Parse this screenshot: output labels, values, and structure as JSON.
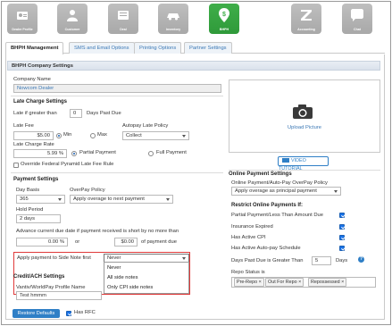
{
  "nav": {
    "items": [
      {
        "label": "Dealer Profile"
      },
      {
        "label": "Customer"
      },
      {
        "label": "Deal"
      },
      {
        "label": "Inventory"
      },
      {
        "label": "BHPH"
      },
      {
        "label": "Accounting"
      },
      {
        "label": "Chat"
      }
    ],
    "active_color": "#3fae49"
  },
  "tabs": [
    {
      "label": "BHPH Management"
    },
    {
      "label": "SMS and Email Options"
    },
    {
      "label": "Printing Options"
    },
    {
      "label": "Partner Settings"
    }
  ],
  "company": {
    "section": "BHPH Company Settings",
    "name_label": "Company Name",
    "name_value": "Nowcom Dealer"
  },
  "late": {
    "heading": "Late Charge Settings",
    "if_greater_label": "Late if greater than",
    "if_greater_value": "0",
    "days_past_due": "Days Past Due",
    "fee_label": "Late Fee",
    "fee_value": "$5.00",
    "min_label": "Min",
    "max_label": "Max",
    "autopay_label": "Autopay Late Policy",
    "autopay_value": "Collect",
    "rate_label": "Late Charge Rate",
    "rate_value": "5.99 %",
    "partial_label": "Partial Payment",
    "full_label": "Full Payment",
    "override_label": "Override Federal Pyramid Late Fee Rule"
  },
  "payment": {
    "heading": "Payment Settings",
    "day_basis_label": "Day Basis",
    "day_basis_value": "365",
    "overpay_label": "OverPay Policy",
    "overpay_value": "Apply overage to next payment",
    "hold_label": "Hold Period",
    "hold_value": "2 days",
    "advance_label": "Advance current due date if payment received is short by no more than",
    "advance_pct": "0.00 %",
    "or_label": "or",
    "advance_amt": "$0.00",
    "of_payment_due": "of payment due",
    "side_note_label": "Apply payment to Side Note first",
    "side_note_value": "Never",
    "side_note_options": [
      "Never",
      "All side notes",
      "Only CPI side notes"
    ]
  },
  "credit": {
    "heading": "Credit/ACH Settings",
    "vantiv_label": "Vantiv/WorldPay Profile Name",
    "vantiv_value": "Test hmmm"
  },
  "photo": {
    "upload_label": "Upload Picture",
    "video_label": "VIDEO TUTORIAL"
  },
  "online": {
    "heading": "Online Payment Settings",
    "overpay_label": "Online Payment/Auto-Pay OverPay Policy",
    "overpay_value": "Apply overage as principal payment",
    "restrict_heading": "Restrict Online Payments If:",
    "restrictions": [
      {
        "label": "Partial Payment/Less Than Amount Due",
        "checked": true
      },
      {
        "label": "Insurance Expired",
        "checked": true
      },
      {
        "label": "Has Active CPI",
        "checked": true
      },
      {
        "label": "Has Active Auto-pay Schedule",
        "checked": true
      }
    ],
    "days_past_label": "Days Past Due is Greater Than",
    "days_past_value": "5",
    "days_label": "Days",
    "help_glyph": "?",
    "repo_label": "Repo Status is",
    "repo_tags": [
      "Pre-Repo",
      "Out For Repo",
      "Repossessed"
    ]
  },
  "footer": {
    "restore_label": "Restore Defaults",
    "rfc_label": "Has RFC"
  },
  "colors": {
    "accent_blue": "#2f7fc6",
    "link_blue": "#3b78b5",
    "highlight_red": "#e03a3a",
    "nav_active_green": "#3fae49"
  }
}
